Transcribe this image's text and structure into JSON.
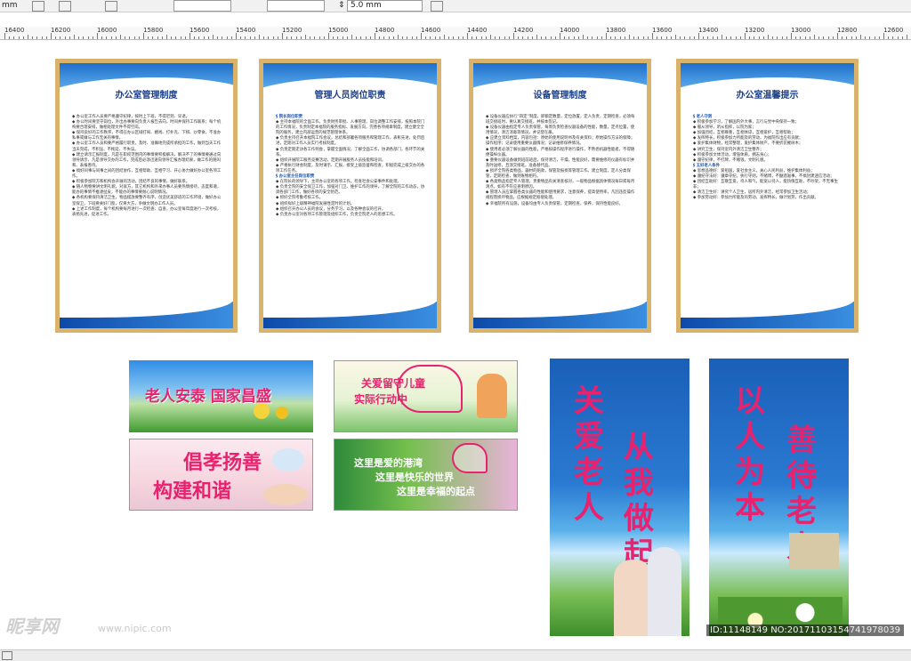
{
  "toolbar": {
    "unit_label": "mm",
    "nudge_value": "5.0 mm"
  },
  "ruler": {
    "ticks": [
      "16400",
      "16200",
      "16000",
      "15800",
      "15600",
      "15400",
      "15200",
      "15000",
      "14800",
      "14600",
      "14400",
      "14200",
      "14000",
      "13800",
      "13600",
      "13400",
      "13200",
      "13000",
      "12800",
      "12600"
    ]
  },
  "boards": [
    {
      "title": "办公室管理制度",
      "lines": [
        "◆ 办公室工作人员要严格遵守纪律，按时上下班，不得迟到、早退。",
        "◆ 办公时间要坚守岗位，外出办事要向负责人报告去向，时间并保持工作联系；每个机构要合理安排，做相处理文件不得空岗。",
        "◆ 保持良好的工作秩序，不得在办公区域打闹、嬉戏、打扑克、下棋、炒零食，不准办私事或做与工作无关的事情。",
        "◆ 办公室工作人员和要严格履行职责，及时、准确地完成所承担的工作，做到当天工作当天完成，不积压、不拖延、不失误。",
        "◆ 建立请示汇报制度，凡是在职权范围内的事情要积极解决，解决不了的事情要通过向领导请示，凡是领导交办的工作，完成后必须迅速向领导汇报办理结果，做工作的随叫和、表报善待。",
        "◆ 搞好同事与同事之间的团结协作，互相帮助、互相学习、开心协力做好办公室各项工作。",
        "◆ 积极参加院方和机构会开展的活动，团结不良的事情，做好联系。",
        "◆ 随人物物要讲文明礼貌，对就方，其它机构和外来办事人员要热情接待，态度和蔼，能办的事情不推诿扯皮，不能办的事情要耐心说明情况。",
        "◆ 各机构要保持清洁卫生，物品摆放要整齐有序，创造优美舒适的工作环境，做好办公室保卫，下班要关好门窗，仅将大方，争做文明办工作人员。",
        "◆ 上述工作制度，每个机构要每月进行一次检查、自查，办公室每年度进行一次考核，表扬先进，促进工作。"
      ]
    },
    {
      "title": "管理人员岗位职责",
      "lines": [
        "§ 院长岗位职责",
        "◆ 主持本福院的全面工作，负责财务审批、人事管理、岗位调整工作安排，按照本院门的工作情况，负责制定本福院的服务指标、发展方向，完善各项规章制度，建立健全全院的服务，建立内部运营的规范管理体系。",
        "◆ 负责主持召开本福院工作会议，总结和部署各项服务和管理工作，表彰先进，处罚后进，定期对工作人员实行考核制度。",
        "◆ 负责定期走访各工作例会，掌握全面情况，了解全面工作，协调各部门，各环节的关系。",
        "◆ 组织开展院工服务竞赛活动，定期开展服务人员技能和培训。",
        "◆ 严格执行财会制度，及时请示、汇报，接受上级监督和检查，积极完成上级交办的各项工作任务。",
        "§ 办公室主任岗位职责",
        "◆ 在院长的领导下，主持办公室的各项工作，检查社会公安事件和处理。",
        "◆ 负责全院的安全保卫工作，加强对门卫、维护工作的领导，了解全院的工作动态，协调各部门工作，做好各项的安全防范。",
        "◆ 抓好全院考勤考核工作。",
        "◆ 组织拟好上级精神福院发展性定时的计划。",
        "◆ 组织召开办公人员的会议，分务学习，以及各种会议的召开。",
        "◆ 负责办公室对各项工作管理及组织工作，负责全院老人的思想工作。"
      ]
    },
    {
      "title": "设备管理制度",
      "lines": [
        "◆ 设备仪器应执行“四定”制度，即额定数量，定位放置，定人负责，定期检查，必须每班交接班时，要认真交接班，并按本签记。",
        "◆ 设备仪器由指定专人负责保管，每周负责检查仪器设备的性能，数量，定点位置，使用情况，清洁消毒等情况，并记登在册。",
        "◆ 应建立资料档案，内容包括：原始的使用说明书及有关资料；原始操作方法的保障；操作程序；记录使用重要仪器情况；记录维修保养情况。",
        "◆ 使用者必须了解仪器的性能，严格按操作程序进行操作，不熟悉机器性能者，不得随便操纵仪器。",
        "◆ 重要仪器设备做到班前班后，保持清洁，干燥，性能良好，需要维修的仪器有标识并及时送修，且须交接班，准备替代品。",
        "◆ 损坏全院各类物品，器材的赔款，保管及报损等管理工作。建立制度，定人分类保管，定期检查，做到账物相符。",
        "◆ 各类物品指定专人管理，贵重物品有关清查核对，一般物品根据具体情况每日或每月清点，如有不符应查明原因。",
        "◆ 管理人员应掌握各类仪器的性能和使用要求，注意保养，提高使用率，凡因违反操作规程而损坏物品，应根据规定赔偿处理。",
        "◆ 幸福院所有设施，设备均由专人负责保管，定期检查，保养，保持性能良好。"
      ]
    },
    {
      "title": "办公室温馨提示",
      "lines": [
        "§ 老人守则",
        "◆ 积极参加学习，了解国内外大事，言行与党中央保持一致；",
        "◆ 服从领导，听从指挥，以院为家；",
        "◆ 加强团结，互相尊重，互相体谅，互相爱护，互相帮助；",
        "◆ 发挥特长，积极参加力所能及的劳动，为福院作出应有贡献；",
        "◆ 爱护集体财物，经常整理，爱护集体财产，不要折花摧树木；",
        "◆ 讲究卫生，保持室内外清洁卫生整齐；",
        "◆ 积极参加文体活动，增强体质，拥志身心；",
        "◆ 遵守纪律，不打牌，不赌钱，文明礼貌。",
        "§ 五好老人条件",
        "◆ 思想品德好：爱祖国，爱社会主义，关心人民利益，维护集体利益；",
        "◆ 遵纪守法好：遵章守纪，执行守则，不赌博，不酗酒滋事，不搞封建迷信活动；",
        "◆ 团结互助好：互敬互爱，待人和气，能宽以待人，能热情互助，不吵架，不无事生非；",
        "◆ 清洁卫生好：讲究个人卫生，居所内外清洁，经常参加卫生活动；",
        "◆ 参加劳动好：参加力所能及的劳动，发挥特长，做计划劳，作出贡献。"
      ]
    }
  ],
  "banners": {
    "b1": "老人安泰  国家昌盛",
    "b2_line1": "关爱留守儿童",
    "b2_line2": "实际行动中",
    "b3_line1": "倡孝扬善",
    "b3_line2": "构建和谐",
    "b4_line1": "这里是爱的港湾",
    "b4_line2": "这里是快乐的世界",
    "b4_line3": "这里是幸福的起点",
    "v1_col1": "关爱老人",
    "v1_col2": "从我做起",
    "v2_col1": "以人为本",
    "v2_col2": "善待老人"
  },
  "watermark": {
    "logo": "昵享网",
    "url": "www.nipic.com",
    "id": "ID:11148149 NO:20171103154741978039"
  },
  "colors": {
    "frame": "#d9b36b",
    "title_blue": "#1d3f86",
    "slogan_pink": "#e8226e"
  }
}
